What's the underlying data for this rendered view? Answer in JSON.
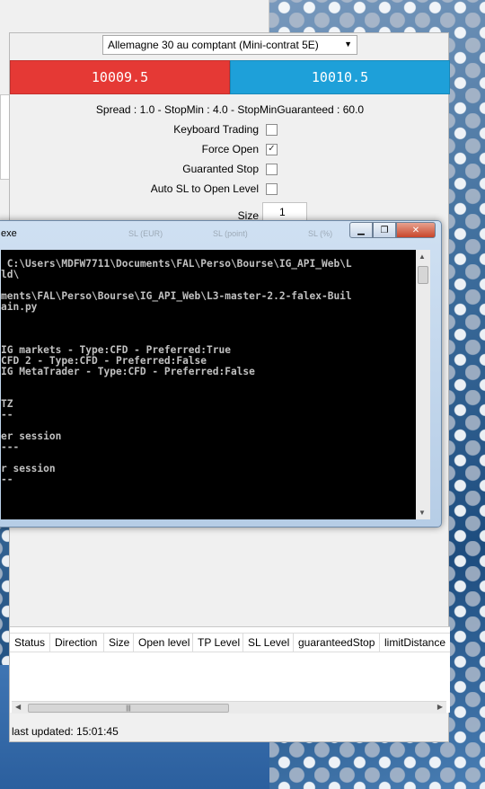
{
  "instrument": {
    "selected": "Allemagne 30 au comptant (Mini-contrat 5E)"
  },
  "prices": {
    "sell": "10009.5",
    "buy": "10010.5",
    "sell_color": "#e53935",
    "buy_color": "#1ea0d9"
  },
  "spread_info": "Spread : 1.0 - StopMin : 4.0 - StopMinGuaranteed : 60.0",
  "options": [
    {
      "label": "Keyboard Trading",
      "checked": false
    },
    {
      "label": "Force Open",
      "checked": true
    },
    {
      "label": "Guaranted Stop",
      "checked": false
    },
    {
      "label": "Auto SL to Open Level",
      "checked": false
    }
  ],
  "size": {
    "label": "Size",
    "value": "1"
  },
  "console": {
    "title": "exe",
    "ghost_headers": [
      "SL (EUR)",
      "SL (point)",
      "SL (%)"
    ],
    "lines": [
      " C:\\Users\\MDFW7711\\Documents\\FAL\\Perso\\Bourse\\IG_API_Web\\L",
      "ld\\",
      "",
      "ments\\FAL\\Perso\\Bourse\\IG_API_Web\\L3-master-2.2-falex-Buil",
      "ain.py",
      "",
      "",
      "",
      "IG markets - Type:CFD - Preferred:True",
      "CFD 2 - Type:CFD - Preferred:False",
      "IG MetaTrader - Type:CFD - Preferred:False",
      "",
      "",
      "TZ",
      "--",
      "",
      "er session",
      "---",
      "",
      "r session",
      "--",
      "",
      ""
    ]
  },
  "table": {
    "columns": [
      "Status",
      "Direction",
      "Size",
      "Open level",
      "TP Level",
      "SL Level",
      "guaranteedStop",
      "limitDistance"
    ],
    "rows": []
  },
  "status_bar": "last updated: 15:01:45"
}
